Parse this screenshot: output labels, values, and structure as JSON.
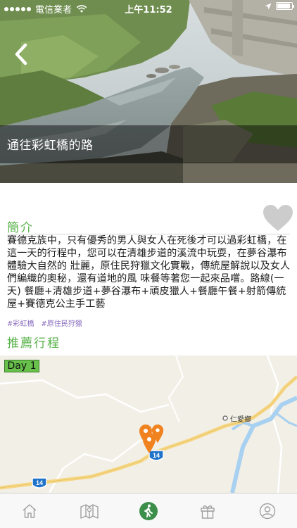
{
  "status_bar": {
    "carrier": "電信業者",
    "time": "上午11:52"
  },
  "header": {
    "title": "通往彩虹橋的路",
    "back_icon": "chevron-left-icon"
  },
  "intro": {
    "heading": "簡介",
    "body": "賽德克族中，只有優秀的男人與女人在死後才可以過彩虹橋，在這一天的行程中，您可以在清雄步道的溪流中玩耍，在夢谷瀑布體驗大自然的 壯麗，原住民狩獵文化實戰，傳統屋解說以及女人們編織的奧秘，還有道地的風 味餐等著您一起來品嚐。路線(一天) 餐廳+清雄步道+夢谷瀑布+頑皮獵人+餐廳午餐+射箭傳統屋+賽德克公主手工藝",
    "favorite_icon": "heart-icon",
    "favorite_color": "#cccccc"
  },
  "tags": [
    "#彩虹橋",
    "#原住民狩獵"
  ],
  "recommend": {
    "heading": "推薦行程",
    "day_label": "Day 1"
  },
  "map": {
    "place_label": "仁愛鄉",
    "route_shields": [
      "14",
      "14"
    ],
    "marker_color": "#f0831f",
    "river_color": "#a8d0f0"
  },
  "tab_bar": {
    "tabs": [
      {
        "icon": "home-icon",
        "active": false
      },
      {
        "icon": "map-icon",
        "active": false
      },
      {
        "icon": "hiking-icon",
        "active": true
      },
      {
        "icon": "gift-icon",
        "active": false
      },
      {
        "icon": "profile-icon",
        "active": false
      }
    ]
  },
  "colors": {
    "accent_green": "#59b24a",
    "tag_purple": "#8a6dc1",
    "tab_active": "#3b8f4a",
    "tab_inactive": "#a0a0a0"
  }
}
